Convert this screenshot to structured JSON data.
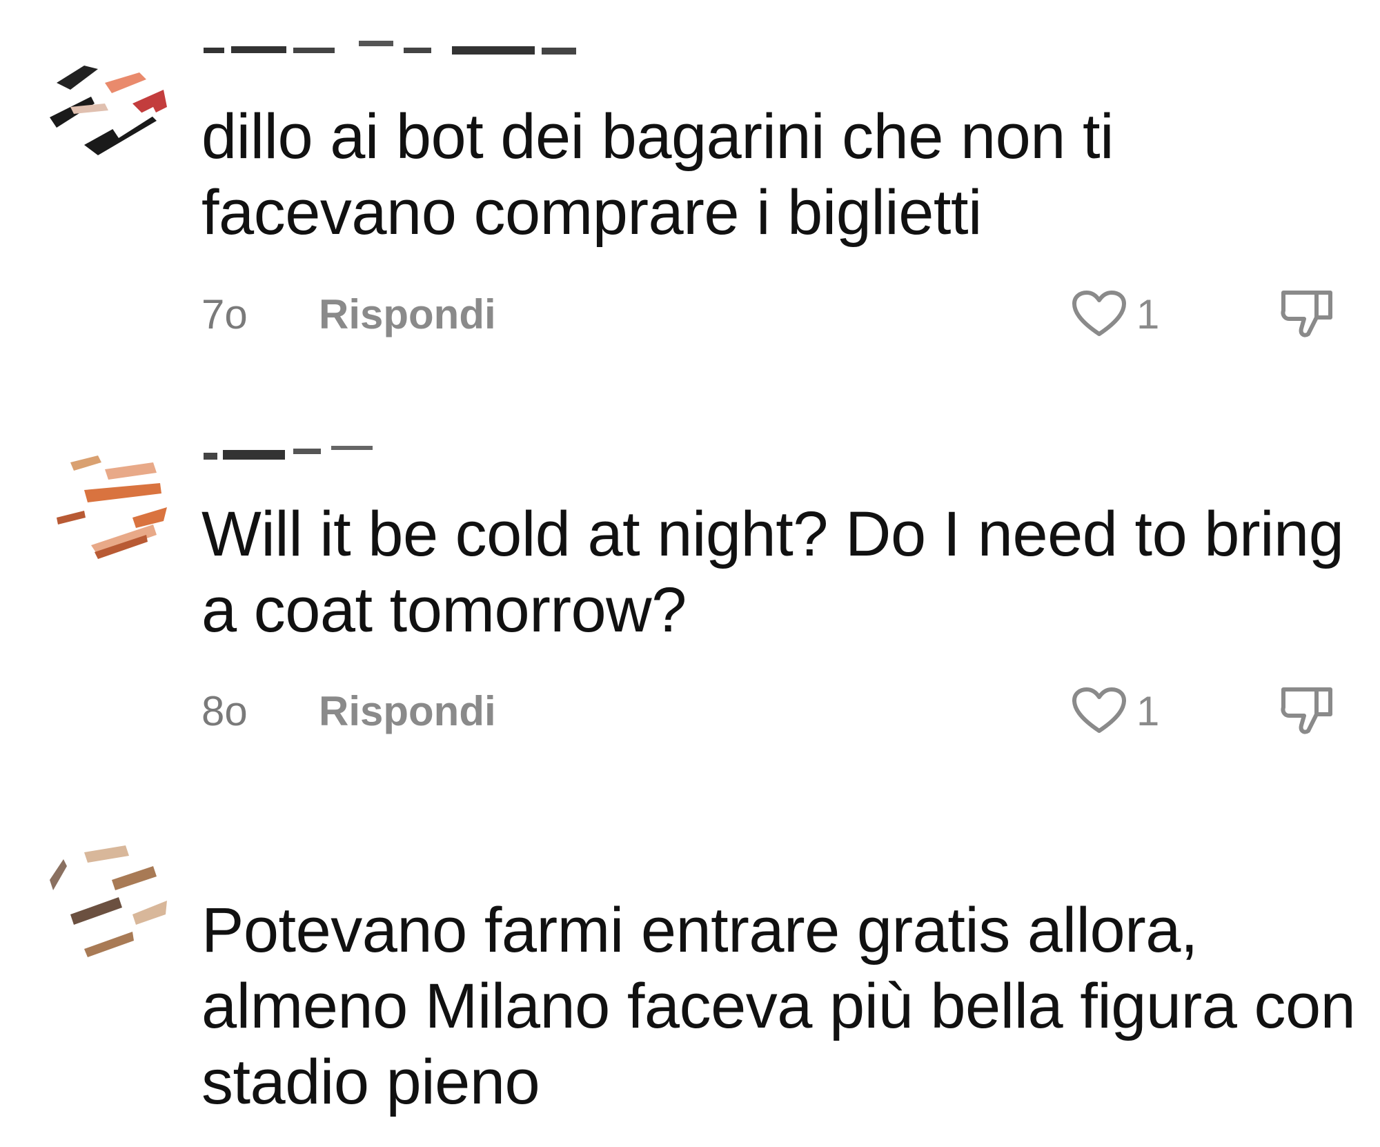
{
  "comments": [
    {
      "username": "",
      "text": "dillo ai bot dei bagarini che non ti facevano comprare i biglietti",
      "time": "7o",
      "reply_label": "Rispondi",
      "like_count": "1",
      "avatar_colors": [
        "#e98a6c",
        "#1a1a1a",
        "#c33d3d"
      ]
    },
    {
      "username": "",
      "text": "Will it be cold at night? Do I need to bring a coat tomorrow?",
      "time": "8o",
      "reply_label": "Rispondi",
      "like_count": "1",
      "avatar_colors": [
        "#d9733f",
        "#e8a988",
        "#b85a34"
      ]
    },
    {
      "username": "",
      "text": "Potevano farmi entrare gratis allora, almeno Milano faceva più bella figura con stadio pieno",
      "time": "",
      "reply_label": "",
      "like_count": "",
      "avatar_colors": [
        "#a87a55",
        "#d8b79a",
        "#6b5040"
      ]
    }
  ],
  "icons": {
    "like": "heart-outline-icon",
    "dislike": "thumbs-down-outline-icon"
  },
  "colors": {
    "text": "#111111",
    "meta": "#8a8a8a",
    "background": "#ffffff"
  }
}
